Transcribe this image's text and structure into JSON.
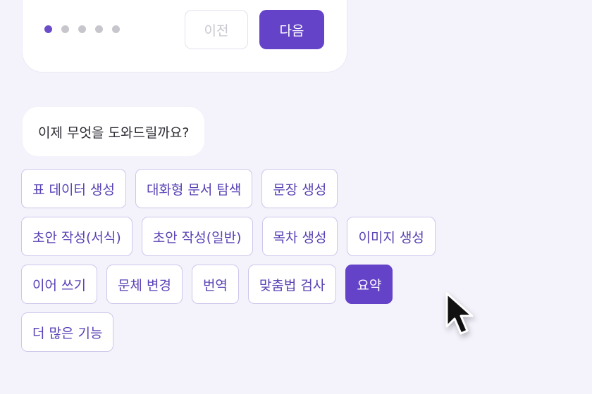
{
  "wizard": {
    "step_count": 5,
    "current_step": 1,
    "prev_label": "이전",
    "next_label": "다음"
  },
  "assistant": {
    "prompt": "이제 무엇을 도와드릴까요?"
  },
  "suggestions": {
    "rows": [
      [
        "표 데이터 생성",
        "대화형 문서 탐색",
        "문장 생성"
      ],
      [
        "초안 작성(서식)",
        "초안 작성(일반)",
        "목차 생성",
        "이미지 생성"
      ],
      [
        "이어 쓰기",
        "문체 변경",
        "번역",
        "맞춤법 검사",
        "요약"
      ],
      [
        "더 많은 기능"
      ]
    ],
    "selected": "요약"
  },
  "colors": {
    "accent": "#6543c9",
    "chip_text": "#5a42b5",
    "chip_border": "#cfc6ec",
    "background": "#f4f2fb"
  },
  "icons": {
    "pointer": "mouse-pointer-icon"
  }
}
